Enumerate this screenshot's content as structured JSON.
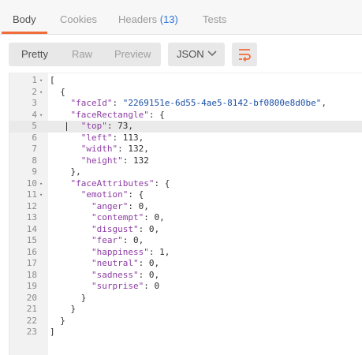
{
  "tabs": [
    {
      "label": "Body"
    },
    {
      "label": "Cookies"
    },
    {
      "label": "Headers ",
      "count": "(13)"
    },
    {
      "label": "Tests"
    }
  ],
  "toolbar": {
    "views": [
      "Pretty",
      "Raw",
      "Preview"
    ],
    "active_view": "Pretty",
    "format": "JSON",
    "wrap_icon": "wrap-lines-icon"
  },
  "editor": {
    "active_line": 5,
    "lines": [
      {
        "n": "1",
        "fold": true,
        "text": "["
      },
      {
        "n": "2",
        "fold": true,
        "text": "  {"
      },
      {
        "n": "3",
        "fold": false,
        "text": "    \"faceId\": \"2269151e-6d55-4ae5-8142-bf0800e8d0be\","
      },
      {
        "n": "4",
        "fold": true,
        "text": "    \"faceRectangle\": {"
      },
      {
        "n": "5",
        "fold": false,
        "text": "      \"top\": 73,"
      },
      {
        "n": "6",
        "fold": false,
        "text": "      \"left\": 113,"
      },
      {
        "n": "7",
        "fold": false,
        "text": "      \"width\": 132,"
      },
      {
        "n": "8",
        "fold": false,
        "text": "      \"height\": 132"
      },
      {
        "n": "9",
        "fold": false,
        "text": "    },"
      },
      {
        "n": "10",
        "fold": true,
        "text": "    \"faceAttributes\": {"
      },
      {
        "n": "11",
        "fold": true,
        "text": "      \"emotion\": {"
      },
      {
        "n": "12",
        "fold": false,
        "text": "        \"anger\": 0,"
      },
      {
        "n": "13",
        "fold": false,
        "text": "        \"contempt\": 0,"
      },
      {
        "n": "14",
        "fold": false,
        "text": "        \"disgust\": 0,"
      },
      {
        "n": "15",
        "fold": false,
        "text": "        \"fear\": 0,"
      },
      {
        "n": "16",
        "fold": false,
        "text": "        \"happiness\": 1,"
      },
      {
        "n": "17",
        "fold": false,
        "text": "        \"neutral\": 0,"
      },
      {
        "n": "18",
        "fold": false,
        "text": "        \"sadness\": 0,"
      },
      {
        "n": "19",
        "fold": false,
        "text": "        \"surprise\": 0"
      },
      {
        "n": "20",
        "fold": false,
        "text": "      }"
      },
      {
        "n": "21",
        "fold": false,
        "text": "    }"
      },
      {
        "n": "22",
        "fold": false,
        "text": "  }"
      },
      {
        "n": "23",
        "fold": false,
        "text": "]"
      }
    ]
  },
  "colors": {
    "accent": "#f26b3a",
    "count": "#2f77d8",
    "key": "#8c3da3",
    "string": "#1a4fa6"
  }
}
